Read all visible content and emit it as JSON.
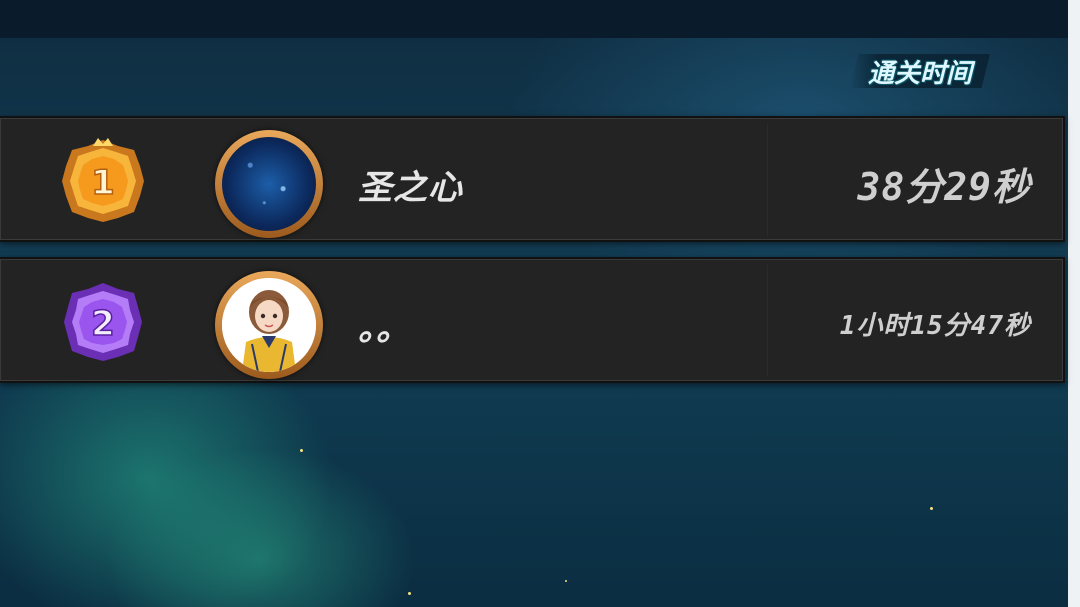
{
  "header": {
    "column_title": "通关时间"
  },
  "leaderboard": [
    {
      "rank": "1",
      "name": "圣之心",
      "time": "38分29秒",
      "badge_color": "#f2a531",
      "avatar": "galaxy-avatar"
    },
    {
      "rank": "2",
      "name": "。。",
      "time": "1小时15分47秒",
      "badge_color": "#a35ff0",
      "avatar": "anime-girl-avatar"
    }
  ],
  "colors": {
    "row_bg": "#232323",
    "avatar_ring": "#d98a3a",
    "gold": "#f2a531",
    "purple": "#a35ff0"
  }
}
